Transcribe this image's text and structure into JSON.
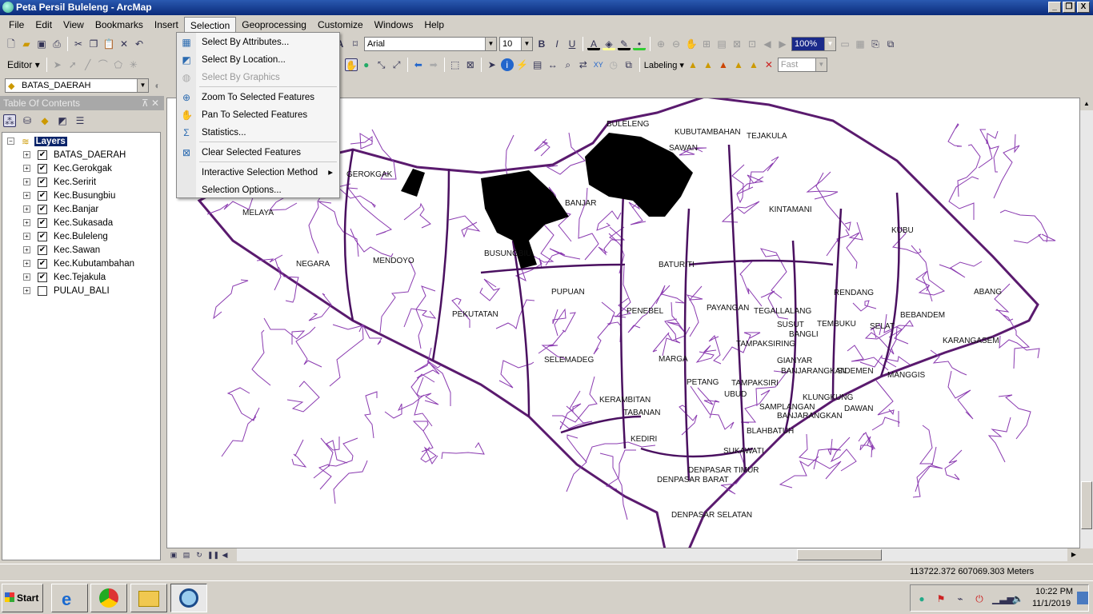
{
  "window": {
    "title": "Peta Persil Buleleng - ArcMap",
    "controls": [
      "_",
      "❐",
      "X"
    ]
  },
  "menubar": [
    "File",
    "Edit",
    "View",
    "Bookmarks",
    "Insert",
    "Selection",
    "Geoprocessing",
    "Customize",
    "Windows",
    "Help"
  ],
  "selection_menu": [
    {
      "label": "Select By Attributes...",
      "icon": "select-by-attributes-icon",
      "enabled": true
    },
    {
      "label": "Select By Location...",
      "icon": "select-by-location-icon",
      "enabled": true
    },
    {
      "label": "Select By Graphics",
      "icon": "select-by-graphics-icon",
      "enabled": false
    },
    {
      "label": "Zoom To Selected Features",
      "icon": "zoom-to-selected-icon",
      "enabled": true
    },
    {
      "label": "Pan To Selected Features",
      "icon": "pan-to-selected-icon",
      "enabled": true
    },
    {
      "label": "Statistics...",
      "icon": "sigma-icon",
      "enabled": true
    },
    {
      "label": "Clear Selected Features",
      "icon": "clear-selection-icon",
      "enabled": true
    },
    {
      "label": "Interactive Selection Method",
      "icon": "",
      "enabled": true,
      "submenu": true
    },
    {
      "label": "Selection Options...",
      "icon": "",
      "enabled": true
    }
  ],
  "toolbar": {
    "editor_label": "Editor",
    "font": "Arial",
    "font_size": "10",
    "zoom_level": "100%",
    "labeling_label": "Labeling",
    "label_quality": "Fast",
    "target_layer": "BATAS_DAERAH"
  },
  "toc": {
    "title": "Table Of Contents",
    "root": "Layers",
    "layers": [
      {
        "name": "BATAS_DAERAH",
        "checked": true
      },
      {
        "name": "Kec.Gerokgak",
        "checked": true
      },
      {
        "name": "Kec.Seririt",
        "checked": true
      },
      {
        "name": "Kec.Busungbiu",
        "checked": true
      },
      {
        "name": "Kec.Banjar",
        "checked": true
      },
      {
        "name": "Kec.Sukasada",
        "checked": true
      },
      {
        "name": "Kec.Buleleng",
        "checked": true
      },
      {
        "name": "Kec.Sawan",
        "checked": true
      },
      {
        "name": "Kec.Kubutambahan",
        "checked": true
      },
      {
        "name": "Kec.Tejakula",
        "checked": true
      },
      {
        "name": "PULAU_BALI",
        "checked": false
      }
    ]
  },
  "map": {
    "labels": [
      "BULELENG",
      "KUBUTAMBAHAN",
      "TEJAKULA",
      "SAWAN",
      "GEROKGAK",
      "MELAYA",
      "BANJAR",
      "KINTAMANI",
      "KUBU",
      "NEGARA",
      "MENDOYO",
      "BUSUNGBIU",
      "BATURITI",
      "PUPUAN",
      "RENDANG",
      "ABANG",
      "PEKUTATAN",
      "PENEBEL",
      "PAYANGAN",
      "TEGALLALANG",
      "SUSUT",
      "BEBANDEM",
      "SELAT",
      "BANGLI",
      "TEMBUKU",
      "KARANGASEM",
      "SELEMADEG",
      "MARGA",
      "TAMPAKSIRING",
      "GIANYAR",
      "BANJARANGKAN",
      "SIDEMEN",
      "MANGGIS",
      "KERAMBITAN",
      "PETANG",
      "TAMPAKSIRI",
      "UBUD",
      "KLUNGKUNG",
      "DAWAN",
      "TABANAN",
      "SUKAWATI",
      "BLAHBATUH",
      "BANJARANGKAN",
      "KEDIRI",
      "DENPASAR TIMUR",
      "DENPASAR BARAT",
      "DENPASAR SELATAN",
      "SAMPLANGAN"
    ],
    "boundary_color": "#5a1a6e",
    "sub_boundary_color": "#7a2aa0",
    "selection_color": "#000000"
  },
  "status": {
    "coordinates": "113722.372  607069.303 Meters"
  },
  "taskbar": {
    "start": "Start",
    "time": "10:22 PM",
    "date": "11/1/2019"
  }
}
